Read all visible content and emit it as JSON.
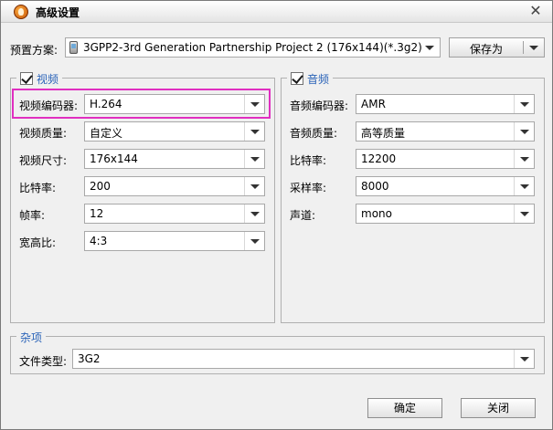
{
  "window": {
    "title": "高级设置",
    "close_symbol": "✕"
  },
  "preset": {
    "label": "预置方案:",
    "value": "3GPP2-3rd Generation Partnership Project 2 (176x144)(*.3g2)",
    "save_as_label": "保存为"
  },
  "video": {
    "title": "视频",
    "checked": true,
    "fields": [
      {
        "label": "视频编码器:",
        "value": "H.264"
      },
      {
        "label": "视频质量:",
        "value": "自定义"
      },
      {
        "label": "视频尺寸:",
        "value": "176x144"
      },
      {
        "label": "比特率:",
        "value": "200"
      },
      {
        "label": "帧率:",
        "value": "12"
      },
      {
        "label": "宽高比:",
        "value": "4:3"
      }
    ]
  },
  "audio": {
    "title": "音频",
    "checked": true,
    "fields": [
      {
        "label": "音频编码器:",
        "value": "AMR"
      },
      {
        "label": "音频质量:",
        "value": "高等质量"
      },
      {
        "label": "比特率:",
        "value": "12200"
      },
      {
        "label": "采样率:",
        "value": "8000"
      },
      {
        "label": "声道:",
        "value": "mono"
      }
    ]
  },
  "misc": {
    "title": "杂项",
    "file_type_label": "文件类型:",
    "file_type_value": "3G2"
  },
  "footer": {
    "ok_label": "确定",
    "close_label": "关闭"
  },
  "colors": {
    "group_title": "#2a63b8",
    "highlight": "#e02fc0",
    "background": "#f0f0f0"
  }
}
